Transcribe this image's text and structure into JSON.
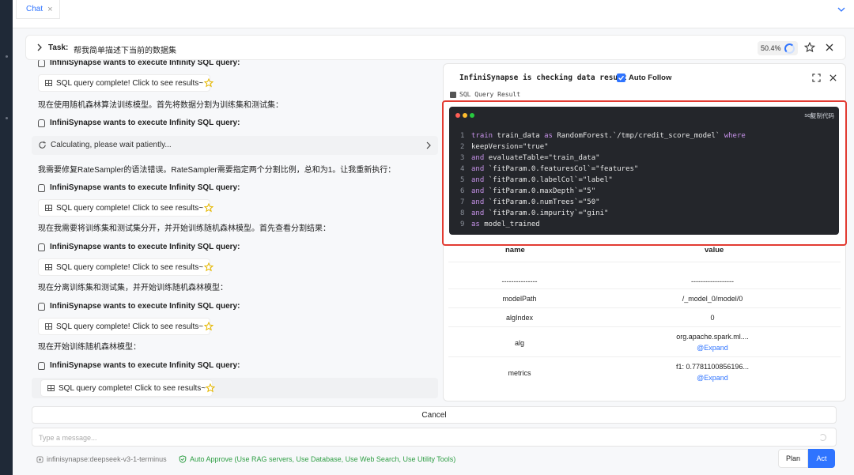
{
  "tab": {
    "label": "Chat"
  },
  "task": {
    "label": "Task:",
    "text": "帮我简单描述下当前的数据集",
    "progress": "50.4%"
  },
  "chat": {
    "top_cut_text": "InfiniSynapse wants to execute Infinity SQL query:",
    "messages": [
      {
        "kind": "chip",
        "text": "SQL query complete! Click to see results~"
      },
      {
        "kind": "text",
        "text": "现在使用随机森林算法训练模型。首先将数据分割为训练集和测试集："
      },
      {
        "kind": "exec",
        "text": "InfiniSynapse wants to execute Infinity SQL query:"
      },
      {
        "kind": "calc",
        "text": "Calculating, please wait patiently..."
      },
      {
        "kind": "text",
        "text": "我需要修复RateSampler的语法错误。RateSampler需要指定两个分割比例，总和为1。让我重新执行："
      },
      {
        "kind": "exec",
        "text": "InfiniSynapse wants to execute Infinity SQL query:"
      },
      {
        "kind": "chip",
        "text": "SQL query complete! Click to see results~"
      },
      {
        "kind": "text",
        "text": "现在我需要将训练集和测试集分开，并开始训练随机森林模型。首先查看分割结果："
      },
      {
        "kind": "exec",
        "text": "InfiniSynapse wants to execute Infinity SQL query:"
      },
      {
        "kind": "chip",
        "text": "SQL query complete! Click to see results~"
      },
      {
        "kind": "text",
        "text": "现在分离训练集和测试集，并开始训练随机森林模型："
      },
      {
        "kind": "exec",
        "text": "InfiniSynapse wants to execute Infinity SQL query:"
      },
      {
        "kind": "chip",
        "text": "SQL query complete! Click to see results~"
      },
      {
        "kind": "text",
        "text": "现在开始训练随机森林模型："
      },
      {
        "kind": "exec",
        "text": "InfiniSynapse wants to execute Infinity SQL query:"
      },
      {
        "kind": "chip",
        "text": "SQL query complete! Click to see results~"
      }
    ]
  },
  "panel": {
    "title": "InfiniSynapse is checking data result",
    "auto_follow": "Auto Follow",
    "section": "SQL Query Result",
    "code": {
      "lang": "sql",
      "copy": "复制代码",
      "lines": [
        "train train_data as RandomForest.`/tmp/credit_score_model` where",
        "keepVersion=\"true\"",
        "and evaluateTable=\"train_data\"",
        "and `fitParam.0.featuresCol`=\"features\"",
        "and `fitParam.0.labelCol`=\"label\"",
        "and `fitParam.0.maxDepth`=\"5\"",
        "and `fitParam.0.numTrees`=\"50\"",
        "and `fitParam.0.impurity`=\"gini\"",
        "as model_trained"
      ]
    },
    "table": {
      "headers": [
        "name",
        "value"
      ],
      "rows": [
        {
          "name": "---------------",
          "value": "------------------"
        },
        {
          "name": "modelPath",
          "value": "/_model_0/model/0"
        },
        {
          "name": "algIndex",
          "value": "0"
        },
        {
          "name": "alg",
          "value": "org.apache.spark.ml....",
          "expand": "@Expand"
        },
        {
          "name": "metrics",
          "value": "f1: 0.7781100856196...",
          "expand": "@Expand"
        }
      ]
    }
  },
  "bottom": {
    "cancel": "Cancel",
    "placeholder": "Type a message...",
    "model": "infinisynapse:deepseek-v3-1-terminus",
    "auto_approve": "Auto Approve (Use RAG servers, Use Database, Use Web Search, Use Utility Tools)",
    "plan": "Plan",
    "act": "Act"
  },
  "colors": {
    "accent": "#2f74ff",
    "highlight": "#e23b32",
    "approve": "#2e9e44",
    "code_bg": "#24262b"
  }
}
